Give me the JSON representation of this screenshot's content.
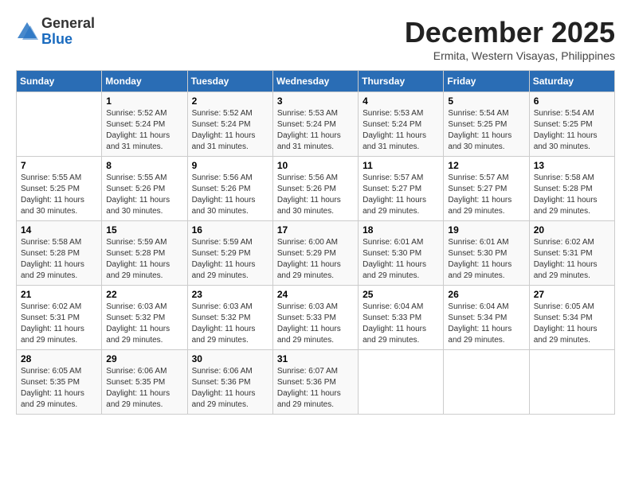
{
  "header": {
    "logo_line1": "General",
    "logo_line2": "Blue",
    "month": "December 2025",
    "location": "Ermita, Western Visayas, Philippines"
  },
  "weekdays": [
    "Sunday",
    "Monday",
    "Tuesday",
    "Wednesday",
    "Thursday",
    "Friday",
    "Saturday"
  ],
  "weeks": [
    [
      {
        "day": "",
        "sunrise": "",
        "sunset": "",
        "daylight": ""
      },
      {
        "day": "1",
        "sunrise": "Sunrise: 5:52 AM",
        "sunset": "Sunset: 5:24 PM",
        "daylight": "Daylight: 11 hours and 31 minutes."
      },
      {
        "day": "2",
        "sunrise": "Sunrise: 5:52 AM",
        "sunset": "Sunset: 5:24 PM",
        "daylight": "Daylight: 11 hours and 31 minutes."
      },
      {
        "day": "3",
        "sunrise": "Sunrise: 5:53 AM",
        "sunset": "Sunset: 5:24 PM",
        "daylight": "Daylight: 11 hours and 31 minutes."
      },
      {
        "day": "4",
        "sunrise": "Sunrise: 5:53 AM",
        "sunset": "Sunset: 5:24 PM",
        "daylight": "Daylight: 11 hours and 31 minutes."
      },
      {
        "day": "5",
        "sunrise": "Sunrise: 5:54 AM",
        "sunset": "Sunset: 5:25 PM",
        "daylight": "Daylight: 11 hours and 30 minutes."
      },
      {
        "day": "6",
        "sunrise": "Sunrise: 5:54 AM",
        "sunset": "Sunset: 5:25 PM",
        "daylight": "Daylight: 11 hours and 30 minutes."
      }
    ],
    [
      {
        "day": "7",
        "sunrise": "Sunrise: 5:55 AM",
        "sunset": "Sunset: 5:25 PM",
        "daylight": "Daylight: 11 hours and 30 minutes."
      },
      {
        "day": "8",
        "sunrise": "Sunrise: 5:55 AM",
        "sunset": "Sunset: 5:26 PM",
        "daylight": "Daylight: 11 hours and 30 minutes."
      },
      {
        "day": "9",
        "sunrise": "Sunrise: 5:56 AM",
        "sunset": "Sunset: 5:26 PM",
        "daylight": "Daylight: 11 hours and 30 minutes."
      },
      {
        "day": "10",
        "sunrise": "Sunrise: 5:56 AM",
        "sunset": "Sunset: 5:26 PM",
        "daylight": "Daylight: 11 hours and 30 minutes."
      },
      {
        "day": "11",
        "sunrise": "Sunrise: 5:57 AM",
        "sunset": "Sunset: 5:27 PM",
        "daylight": "Daylight: 11 hours and 29 minutes."
      },
      {
        "day": "12",
        "sunrise": "Sunrise: 5:57 AM",
        "sunset": "Sunset: 5:27 PM",
        "daylight": "Daylight: 11 hours and 29 minutes."
      },
      {
        "day": "13",
        "sunrise": "Sunrise: 5:58 AM",
        "sunset": "Sunset: 5:28 PM",
        "daylight": "Daylight: 11 hours and 29 minutes."
      }
    ],
    [
      {
        "day": "14",
        "sunrise": "Sunrise: 5:58 AM",
        "sunset": "Sunset: 5:28 PM",
        "daylight": "Daylight: 11 hours and 29 minutes."
      },
      {
        "day": "15",
        "sunrise": "Sunrise: 5:59 AM",
        "sunset": "Sunset: 5:28 PM",
        "daylight": "Daylight: 11 hours and 29 minutes."
      },
      {
        "day": "16",
        "sunrise": "Sunrise: 5:59 AM",
        "sunset": "Sunset: 5:29 PM",
        "daylight": "Daylight: 11 hours and 29 minutes."
      },
      {
        "day": "17",
        "sunrise": "Sunrise: 6:00 AM",
        "sunset": "Sunset: 5:29 PM",
        "daylight": "Daylight: 11 hours and 29 minutes."
      },
      {
        "day": "18",
        "sunrise": "Sunrise: 6:01 AM",
        "sunset": "Sunset: 5:30 PM",
        "daylight": "Daylight: 11 hours and 29 minutes."
      },
      {
        "day": "19",
        "sunrise": "Sunrise: 6:01 AM",
        "sunset": "Sunset: 5:30 PM",
        "daylight": "Daylight: 11 hours and 29 minutes."
      },
      {
        "day": "20",
        "sunrise": "Sunrise: 6:02 AM",
        "sunset": "Sunset: 5:31 PM",
        "daylight": "Daylight: 11 hours and 29 minutes."
      }
    ],
    [
      {
        "day": "21",
        "sunrise": "Sunrise: 6:02 AM",
        "sunset": "Sunset: 5:31 PM",
        "daylight": "Daylight: 11 hours and 29 minutes."
      },
      {
        "day": "22",
        "sunrise": "Sunrise: 6:03 AM",
        "sunset": "Sunset: 5:32 PM",
        "daylight": "Daylight: 11 hours and 29 minutes."
      },
      {
        "day": "23",
        "sunrise": "Sunrise: 6:03 AM",
        "sunset": "Sunset: 5:32 PM",
        "daylight": "Daylight: 11 hours and 29 minutes."
      },
      {
        "day": "24",
        "sunrise": "Sunrise: 6:03 AM",
        "sunset": "Sunset: 5:33 PM",
        "daylight": "Daylight: 11 hours and 29 minutes."
      },
      {
        "day": "25",
        "sunrise": "Sunrise: 6:04 AM",
        "sunset": "Sunset: 5:33 PM",
        "daylight": "Daylight: 11 hours and 29 minutes."
      },
      {
        "day": "26",
        "sunrise": "Sunrise: 6:04 AM",
        "sunset": "Sunset: 5:34 PM",
        "daylight": "Daylight: 11 hours and 29 minutes."
      },
      {
        "day": "27",
        "sunrise": "Sunrise: 6:05 AM",
        "sunset": "Sunset: 5:34 PM",
        "daylight": "Daylight: 11 hours and 29 minutes."
      }
    ],
    [
      {
        "day": "28",
        "sunrise": "Sunrise: 6:05 AM",
        "sunset": "Sunset: 5:35 PM",
        "daylight": "Daylight: 11 hours and 29 minutes."
      },
      {
        "day": "29",
        "sunrise": "Sunrise: 6:06 AM",
        "sunset": "Sunset: 5:35 PM",
        "daylight": "Daylight: 11 hours and 29 minutes."
      },
      {
        "day": "30",
        "sunrise": "Sunrise: 6:06 AM",
        "sunset": "Sunset: 5:36 PM",
        "daylight": "Daylight: 11 hours and 29 minutes."
      },
      {
        "day": "31",
        "sunrise": "Sunrise: 6:07 AM",
        "sunset": "Sunset: 5:36 PM",
        "daylight": "Daylight: 11 hours and 29 minutes."
      },
      {
        "day": "",
        "sunrise": "",
        "sunset": "",
        "daylight": ""
      },
      {
        "day": "",
        "sunrise": "",
        "sunset": "",
        "daylight": ""
      },
      {
        "day": "",
        "sunrise": "",
        "sunset": "",
        "daylight": ""
      }
    ]
  ]
}
